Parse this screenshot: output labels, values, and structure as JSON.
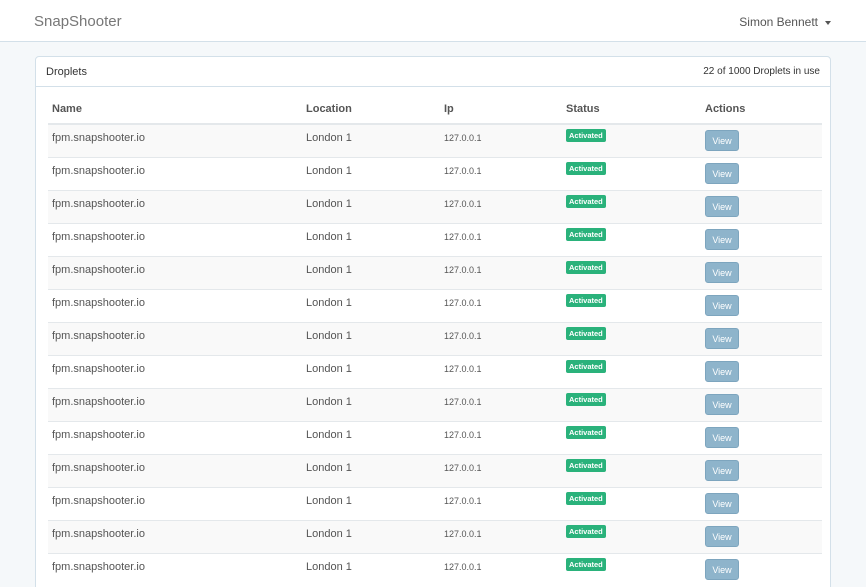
{
  "navbar": {
    "brand": "SnapShooter",
    "user_name": "Simon Bennett"
  },
  "panel": {
    "title": "Droplets",
    "usage_count": "22 of 1000",
    "usage_suffix": "Droplets in use"
  },
  "table": {
    "columns": [
      "Name",
      "Location",
      "Ip",
      "Status",
      "Actions"
    ],
    "rows": [
      {
        "name": "fpm.snapshooter.io",
        "location": "London 1",
        "ip": "127.0.0.1",
        "status": "Activated",
        "action": "View"
      },
      {
        "name": "fpm.snapshooter.io",
        "location": "London 1",
        "ip": "127.0.0.1",
        "status": "Activated",
        "action": "View"
      },
      {
        "name": "fpm.snapshooter.io",
        "location": "London 1",
        "ip": "127.0.0.1",
        "status": "Activated",
        "action": "View"
      },
      {
        "name": "fpm.snapshooter.io",
        "location": "London 1",
        "ip": "127.0.0.1",
        "status": "Activated",
        "action": "View"
      },
      {
        "name": "fpm.snapshooter.io",
        "location": "London 1",
        "ip": "127.0.0.1",
        "status": "Activated",
        "action": "View"
      },
      {
        "name": "fpm.snapshooter.io",
        "location": "London 1",
        "ip": "127.0.0.1",
        "status": "Activated",
        "action": "View"
      },
      {
        "name": "fpm.snapshooter.io",
        "location": "London 1",
        "ip": "127.0.0.1",
        "status": "Activated",
        "action": "View"
      },
      {
        "name": "fpm.snapshooter.io",
        "location": "London 1",
        "ip": "127.0.0.1",
        "status": "Activated",
        "action": "View"
      },
      {
        "name": "fpm.snapshooter.io",
        "location": "London 1",
        "ip": "127.0.0.1",
        "status": "Activated",
        "action": "View"
      },
      {
        "name": "fpm.snapshooter.io",
        "location": "London 1",
        "ip": "127.0.0.1",
        "status": "Activated",
        "action": "View"
      },
      {
        "name": "fpm.snapshooter.io",
        "location": "London 1",
        "ip": "127.0.0.1",
        "status": "Activated",
        "action": "View"
      },
      {
        "name": "fpm.snapshooter.io",
        "location": "London 1",
        "ip": "127.0.0.1",
        "status": "Activated",
        "action": "View"
      },
      {
        "name": "fpm.snapshooter.io",
        "location": "London 1",
        "ip": "127.0.0.1",
        "status": "Activated",
        "action": "View"
      },
      {
        "name": "fpm.snapshooter.io",
        "location": "London 1",
        "ip": "127.0.0.1",
        "status": "Activated",
        "action": "View"
      }
    ]
  },
  "colors": {
    "status_badge": "#2ab27b",
    "view_button": "#8eb4cb",
    "page_background": "#f5f8fa"
  }
}
